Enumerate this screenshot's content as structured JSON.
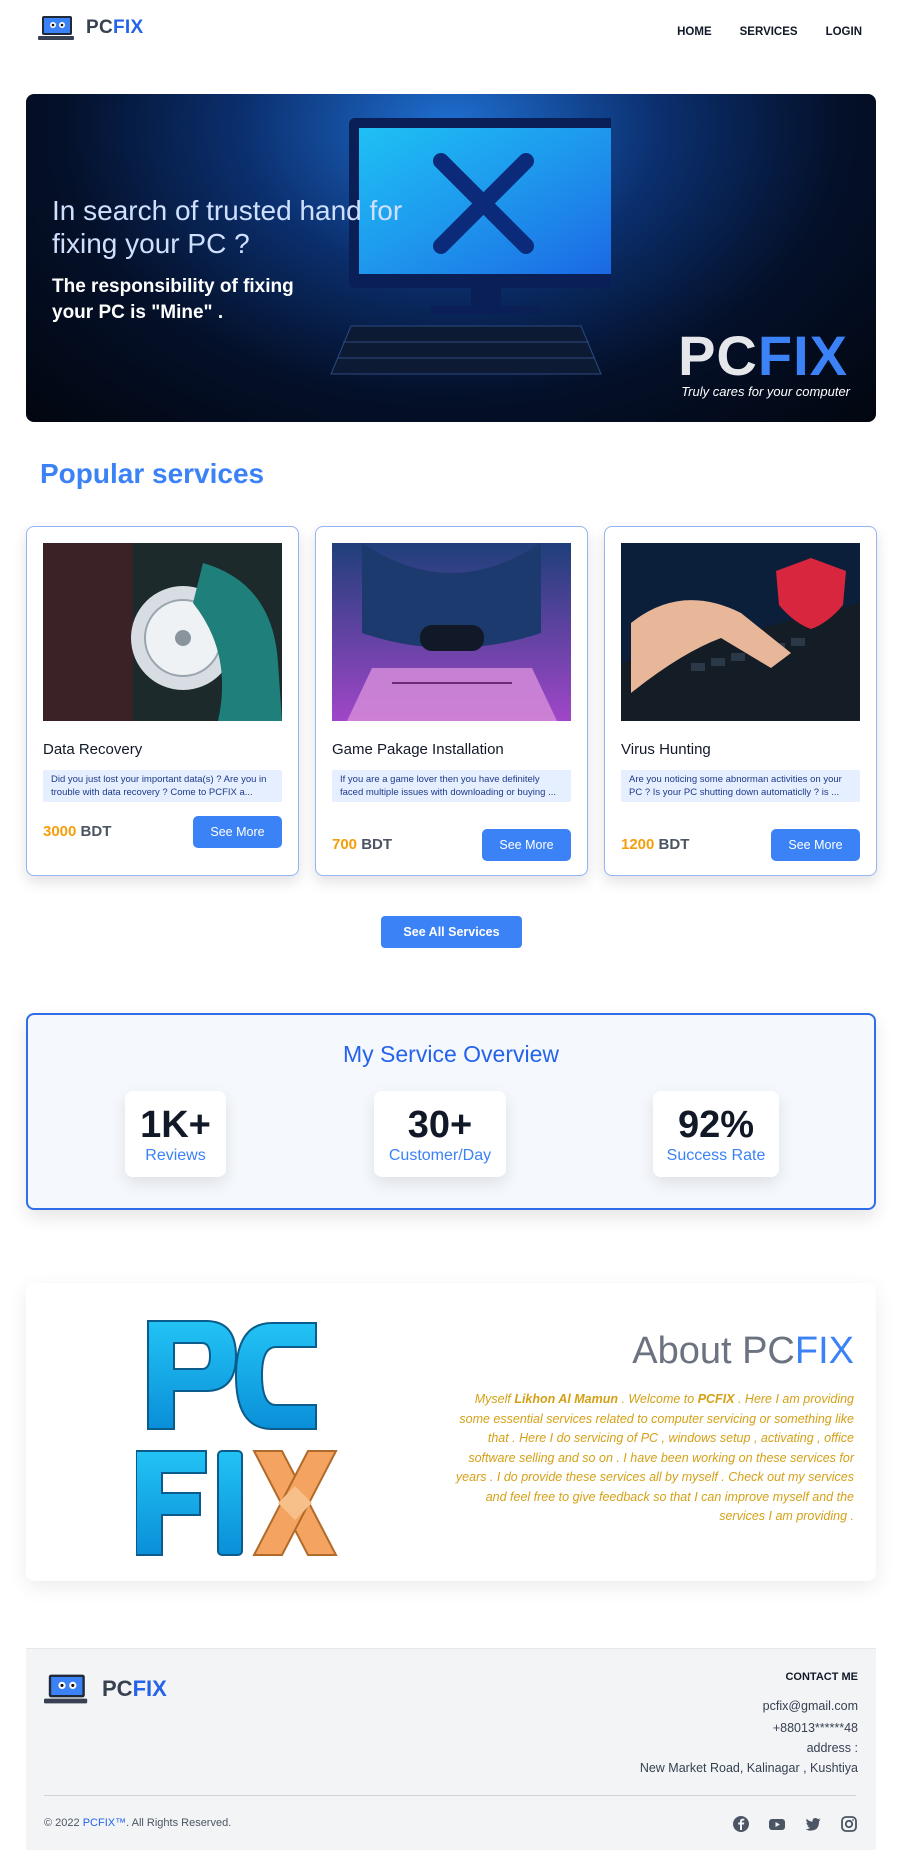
{
  "nav": {
    "brand_main": "PC",
    "brand_accent": "FIX",
    "links": [
      "HOME",
      "SERVICES",
      "LOGIN"
    ]
  },
  "hero": {
    "title": "In search of trusted hand for fixing your PC ?",
    "subtitle": "The responsibility of fixing your PC is \"Mine\" .",
    "brand_main": "PC",
    "brand_accent": "FIX",
    "tagline": "Truly cares for your computer"
  },
  "popular": {
    "title": "Popular services",
    "cards": [
      {
        "title": "Data Recovery",
        "desc": "Did you just lost your important data(s) ? Are you in trouble with data recovery ? Come to PCFIX a...",
        "price": "3000",
        "currency": "BDT",
        "button": "See More"
      },
      {
        "title": "Game Pakage Installation",
        "desc": "If you are a game lover then you have definitely faced multiple issues with downloading or buying ...",
        "price": "700",
        "currency": "BDT",
        "button": "See More"
      },
      {
        "title": "Virus Hunting",
        "desc": "Are you noticing some abnorman activities on your PC ? Is your PC shutting down automaticlly ? is ...",
        "price": "1200",
        "currency": "BDT",
        "button": "See More"
      }
    ],
    "see_all": "See All Services"
  },
  "overview": {
    "title": "My Service Overview",
    "stats": [
      {
        "value": "1K+",
        "label": "Reviews"
      },
      {
        "value": "30+",
        "label": "Customer/Day"
      },
      {
        "value": "92%",
        "label": "Success Rate"
      }
    ]
  },
  "about": {
    "title_main": "About PC",
    "title_accent": "FIX",
    "text_1": "Myself ",
    "name": "Likhon Al Mamun",
    "text_2": " . Welcome to ",
    "brand": "PCFIX",
    "text_3": " . Here I am providing some essential services related to computer servicing or something like that . Here I do servicing of PC , windows setup , activating , office software selling and so on . I have been working on these services for years . I do provide these services all by myself . Check out my services and feel free to give feedback so that I can improve myself and the services I am providing ."
  },
  "footer": {
    "brand_main": "PC",
    "brand_accent": "FIX",
    "contact_heading": "CONTACT ME",
    "email": "pcfix@gmail.com",
    "phone": "+88013******48",
    "address_label": "address :",
    "address": "New Market Road, Kalinagar , Kushtiya",
    "copy_prefix": "© 2022 ",
    "copy_brand": "PCFIX™",
    "copy_suffix": ". All Rights Reserved.",
    "socials": [
      "facebook-icon",
      "youtube-icon",
      "twitter-icon",
      "instagram-icon"
    ]
  },
  "colors": {
    "accent": "#3b82f6",
    "price": "#f59e0b",
    "about_text": "#d4a017"
  }
}
